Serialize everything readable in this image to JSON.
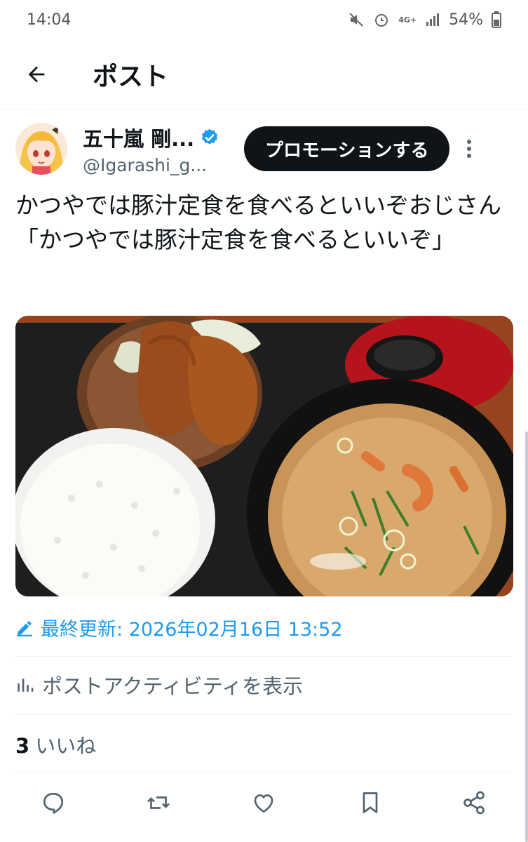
{
  "status": {
    "time": "14:04",
    "network": "4G+",
    "battery": "54%"
  },
  "header": {
    "title": "ポスト"
  },
  "author": {
    "display_name": "五十嵐 剛...",
    "handle": "@Igarashi_g...",
    "verified": true
  },
  "promote_label": "プロモーションする",
  "post": {
    "text": "かつやでは豚汁定食を食べるといいぞおじさん「かつやでは豚汁定食を食べるといいぞ」"
  },
  "edited": {
    "label": "最終更新: 2026年02月16日 13:52"
  },
  "activity_label": "ポストアクティビティを表示",
  "likes": {
    "count": "3",
    "label": "いいね"
  },
  "colors": {
    "accent": "#1d9bf0",
    "text": "#0f1419",
    "muted": "#536471"
  },
  "icons": [
    "back-arrow-icon",
    "verified-badge-icon",
    "more-icon",
    "edit-icon",
    "analytics-icon",
    "reply-icon",
    "repost-icon",
    "like-icon",
    "bookmark-icon",
    "share-icon"
  ]
}
